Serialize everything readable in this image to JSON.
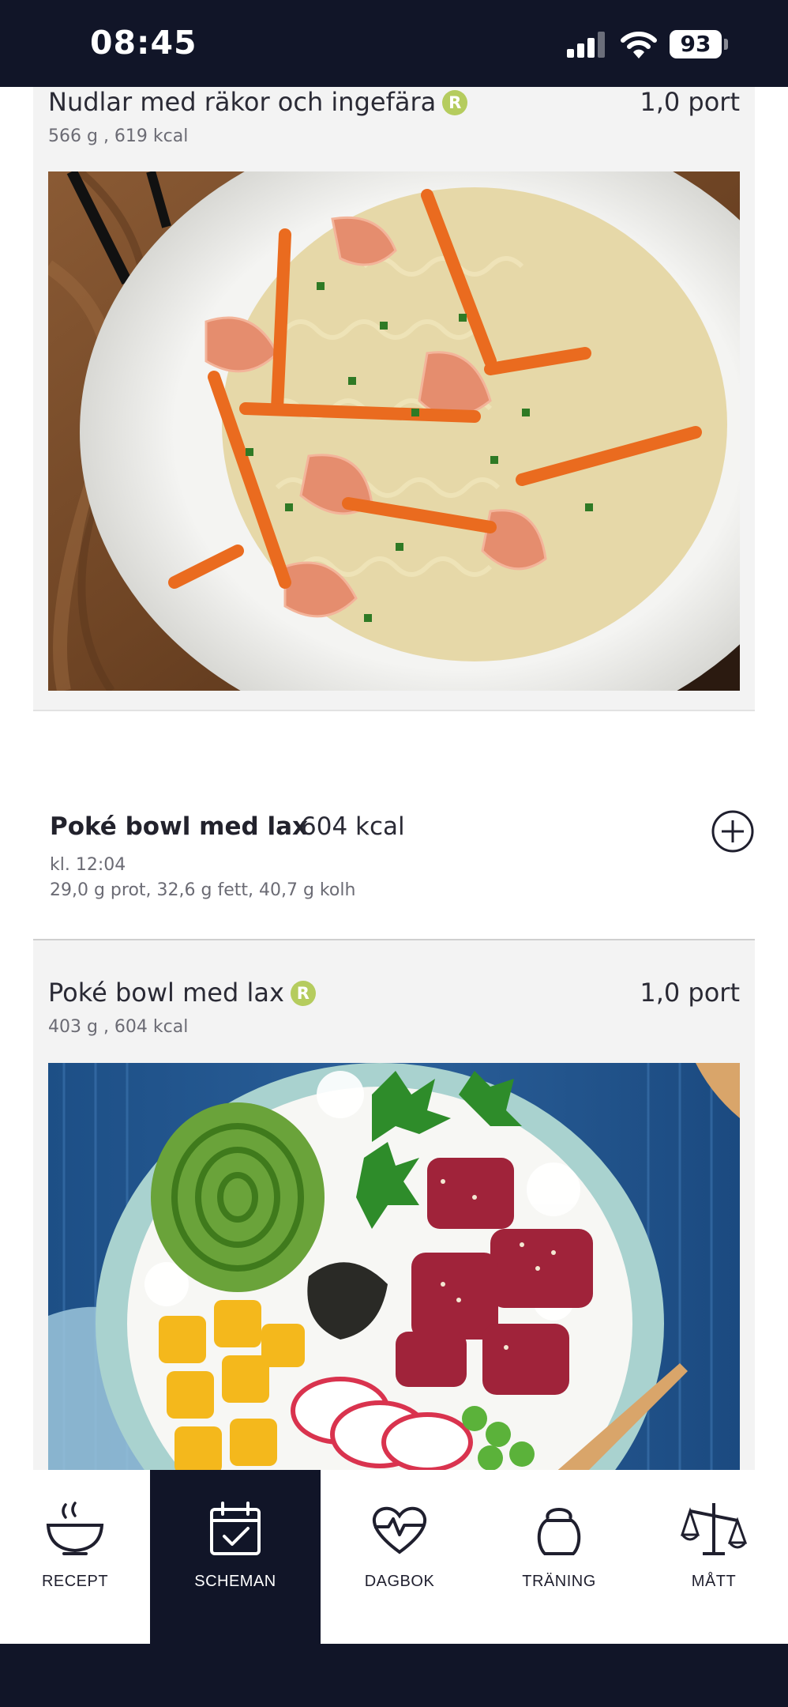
{
  "status_bar": {
    "time": "08:45",
    "battery": "93"
  },
  "cards": [
    {
      "title": "Nudlar med räkor och ingefära",
      "badge": "R",
      "portion": "1,0 port",
      "meta": "566 g , 619 kcal",
      "image": "shrimp-noodle-bowl-photo"
    },
    {
      "title": "Poké bowl med lax",
      "badge": "R",
      "portion": "1,0 port",
      "meta": "403 g , 604 kcal",
      "image": "poke-bowl-salmon-photo"
    }
  ],
  "meal": {
    "name": "Poké bowl med lax",
    "kcal": "604 kcal",
    "time": "kl. 12:04",
    "macros": "29,0 g prot, 32,6 g fett, 40,7 g kolh",
    "add_icon": "plus-circle-icon"
  },
  "nav": {
    "active": "scheman",
    "items": [
      {
        "label": "RECEPT",
        "icon": "bowl-icon"
      },
      {
        "label": "SCHEMAN",
        "icon": "calendar-check-icon"
      },
      {
        "label": "DAGBOK",
        "icon": "heart-pulse-icon"
      },
      {
        "label": "TRÄNING",
        "icon": "kettlebell-icon"
      },
      {
        "label": "MÅTT",
        "icon": "scale-icon"
      }
    ]
  },
  "colors": {
    "dark": "#111528",
    "badge": "#b5cc5e",
    "card_bg": "#f3f3f3"
  }
}
